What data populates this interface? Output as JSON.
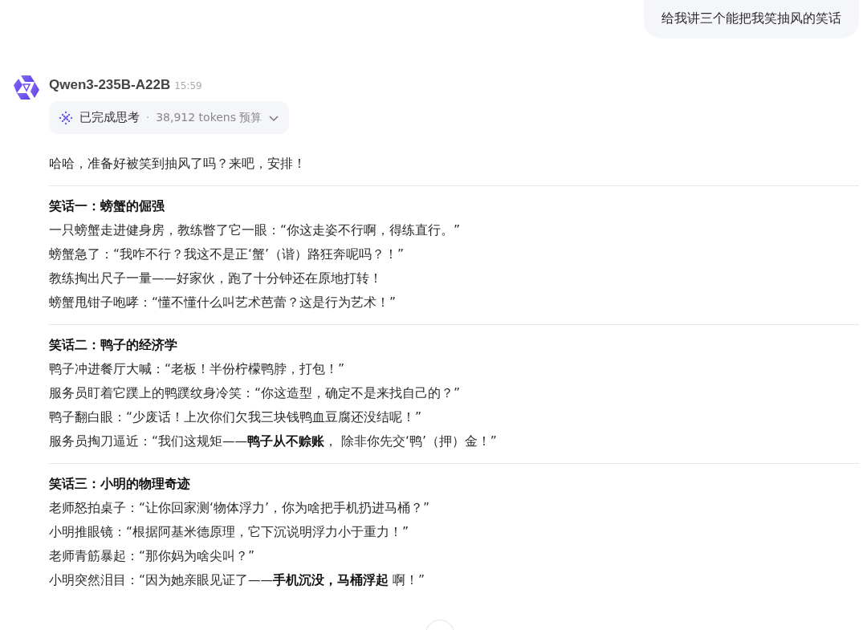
{
  "user_message": "给我讲三个能把我笑抽风的笑话",
  "assistant": {
    "model": "Qwen3-235B-A22B",
    "time": "15:59",
    "thinking": {
      "label": "已完成思考",
      "separator": "·",
      "budget": "38,912 tokens 预算",
      "expanded": false
    },
    "intro": "哈哈，准备好被笑到抽风了吗？来吧，安排！",
    "jokes": [
      {
        "title": "笑话一：螃蟹的倔强",
        "lines": [
          "一只螃蟹走进健身房，教练瞥了它一眼：“你这走姿不行啊，得练直行。”",
          "螃蟹急了：“我咋不行？我这不是正‘蟹’（谐）路狂奔呢吗？！”",
          "教练掏出尺子一量——好家伙，跑了十分钟还在原地打转！",
          "螃蟹甩钳子咆哮：“懂不懂什么叫艺术芭蕾？这是行为艺术！”"
        ]
      },
      {
        "title": "笑话二：鸭子的经济学",
        "lines": [
          "鸭子冲进餐厅大喊：“老板！半份柠檬鸭脖，打包！”",
          "服务员盯着它蹼上的鸭蹼纹身冷笑：“你这造型，确定不是来找自己的？”",
          "鸭子翻白眼：“少废话！上次你们欠我三块钱鸭血豆腐还没结呢！”",
          "服务员掏刀逼近：“我们这规矩——**鸭子从不赊账**， 除非你先交‘鸭’（押）金！”"
        ]
      },
      {
        "title": "笑话三：小明的物理奇迹",
        "lines": [
          "老师怒拍桌子：“让你回家测‘物体浮力’，你为啥把手机扔进马桶？”",
          "小明推眼镜：“根据阿基米德原理，它下沉说明浮力小于重力！”",
          "老师青筋暴起：“那你妈为啥尖叫？”",
          "小明突然泪目：“因为她亲眼见证了——**手机沉没，马桶浮起** 啊！”"
        ]
      }
    ]
  }
}
